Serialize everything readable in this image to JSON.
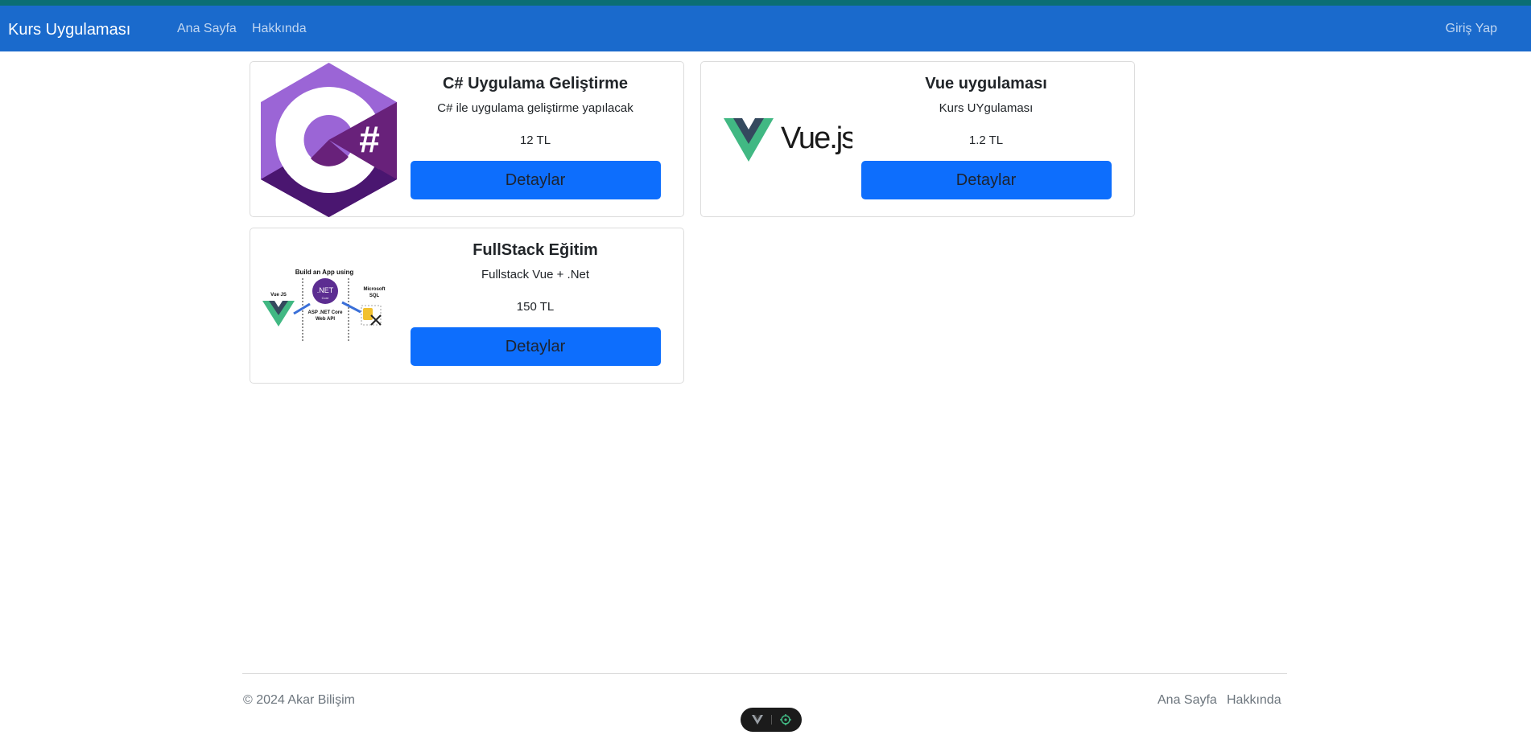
{
  "navbar": {
    "brand": "Kurs Uygulaması",
    "links": [
      "Ana Sayfa",
      "Hakkında"
    ],
    "login": "Giriş Yap"
  },
  "courses": [
    {
      "title": "C# Uygulama Geliştirme",
      "description": "C# ile uygulama geliştirme yapılacak",
      "price": "12 TL",
      "button": "Detaylar",
      "image_icon": "csharp-logo",
      "image_text": "#"
    },
    {
      "title": "Vue uygulaması",
      "description": "Kurs UYgulaması",
      "price": "1.2 TL",
      "button": "Detaylar",
      "image_icon": "vuejs-logo",
      "image_text": "Vue.js"
    },
    {
      "title": "FullStack Eğitim",
      "description": "Fullstack Vue + .Net",
      "price": "150 TL",
      "button": "Detaylar",
      "image_icon": "fullstack-diagram",
      "image_text": {
        "heading": "Build an App using",
        "left": "Vue JS",
        "center_logo": ".NET",
        "center_sub": "Core",
        "center_caption_1": "ASP .NET Core",
        "center_caption_2": "Web API",
        "right_1": "Microsoft",
        "right_2": "SQL"
      }
    }
  ],
  "footer": {
    "copyright": "© 2024 Akar Bilişim",
    "links": [
      "Ana Sayfa",
      "Hakkında"
    ]
  },
  "colors": {
    "navbar": "#1a6acc",
    "button": "#0d6efd",
    "csharp_purple": "#9b4f96",
    "vue_green": "#41b883",
    "vue_dark": "#34495e"
  }
}
